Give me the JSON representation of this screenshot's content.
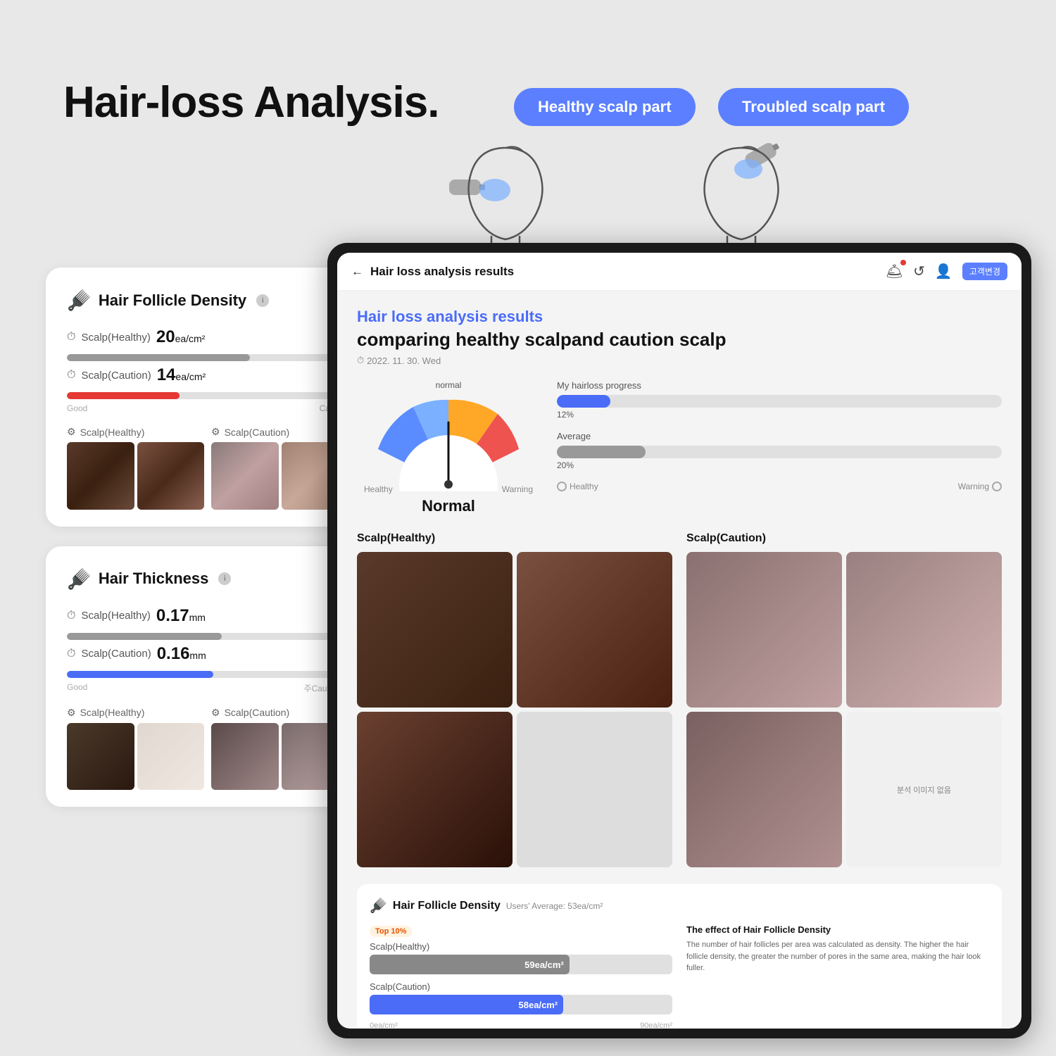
{
  "page": {
    "title": "Hair-loss Analysis.",
    "bg_color": "#e8e8e8"
  },
  "header": {
    "healthy_btn": "Healthy scalp part",
    "troubled_btn": "Troubled scalp part"
  },
  "left_panel": {
    "card1": {
      "title": "Hair Follicle Density",
      "icon": "🪮",
      "healthy_label": "Scalp(Healthy)",
      "healthy_value": "20",
      "healthy_unit": "ea/cm²",
      "caution_label": "Scalp(Caution)",
      "caution_value": "14",
      "caution_unit": "ea/cm²",
      "bar_good": "Good",
      "bar_caution": "Caution",
      "healthy_bar_pct": 65,
      "caution_bar_pct": 40,
      "scalp_healthy_label": "Scalp(Healthy)",
      "scalp_caution_label": "Scalp(Caution)"
    },
    "card2": {
      "title": "Hair Thickness",
      "icon": "🪮",
      "healthy_label": "Scalp(Healthy)",
      "healthy_value": "0.17",
      "healthy_unit": "mm",
      "caution_label": "Scalp(Caution)",
      "caution_value": "0.16",
      "caution_unit": "mm",
      "bar_good": "Good",
      "bar_caution": "주Caution의",
      "healthy_bar_pct": 55,
      "caution_bar_pct": 52,
      "scalp_healthy_label": "Scalp(Healthy)",
      "scalp_caution_label": "Scalp(Caution)"
    }
  },
  "tablet": {
    "topbar": {
      "back_label": "Hair loss analysis results",
      "goback_btn": "고객변경"
    },
    "content": {
      "result_title": "Hair loss analysis results",
      "result_subtitle": "comparing healthy scalpand caution scalp",
      "date": "2022. 11. 30. Wed",
      "gauge": {
        "normal_label": "normal",
        "healthy_label": "Healthy",
        "warning_label": "Warning",
        "reading": "Normal"
      },
      "progress": {
        "my_label": "My hairloss progress",
        "my_pct": 12,
        "my_pct_label": "12%",
        "avg_label": "Average",
        "avg_pct": 20,
        "avg_pct_label": "20%",
        "healthy_end": "Healthy",
        "warning_end": "Warning"
      },
      "scalp_healthy": {
        "title": "Scalp(Healthy)",
        "cell4_empty": ""
      },
      "scalp_caution": {
        "title": "Scalp(Caution)",
        "cell4_label": "분석 이미지 없음"
      },
      "density": {
        "title": "Hair Follicle Density",
        "users_avg": "Users' Average: 53ea/cm²",
        "top10": "Top 10%",
        "healthy_label": "Scalp(Healthy)",
        "healthy_value": "59ea/cm²",
        "healthy_pct": 66,
        "caution_label": "Scalp(Caution)",
        "caution_value": "58ea/cm²",
        "caution_pct": 64,
        "bar_start": "0ea/cm²",
        "bar_end": "90ea/cm²",
        "effect_title": "The effect of Hair Follicle Density",
        "effect_body": "The number of hair follicles per area was calculated as density. The higher the hair follicle density, the greater the number of pores in the same area, making the hair look fuller."
      }
    }
  },
  "icons": {
    "back_arrow": "←",
    "chevron_down": "∨",
    "clock": "⏱",
    "refresh": "↺",
    "person": "👤",
    "circle_small": "○",
    "info": "i"
  }
}
